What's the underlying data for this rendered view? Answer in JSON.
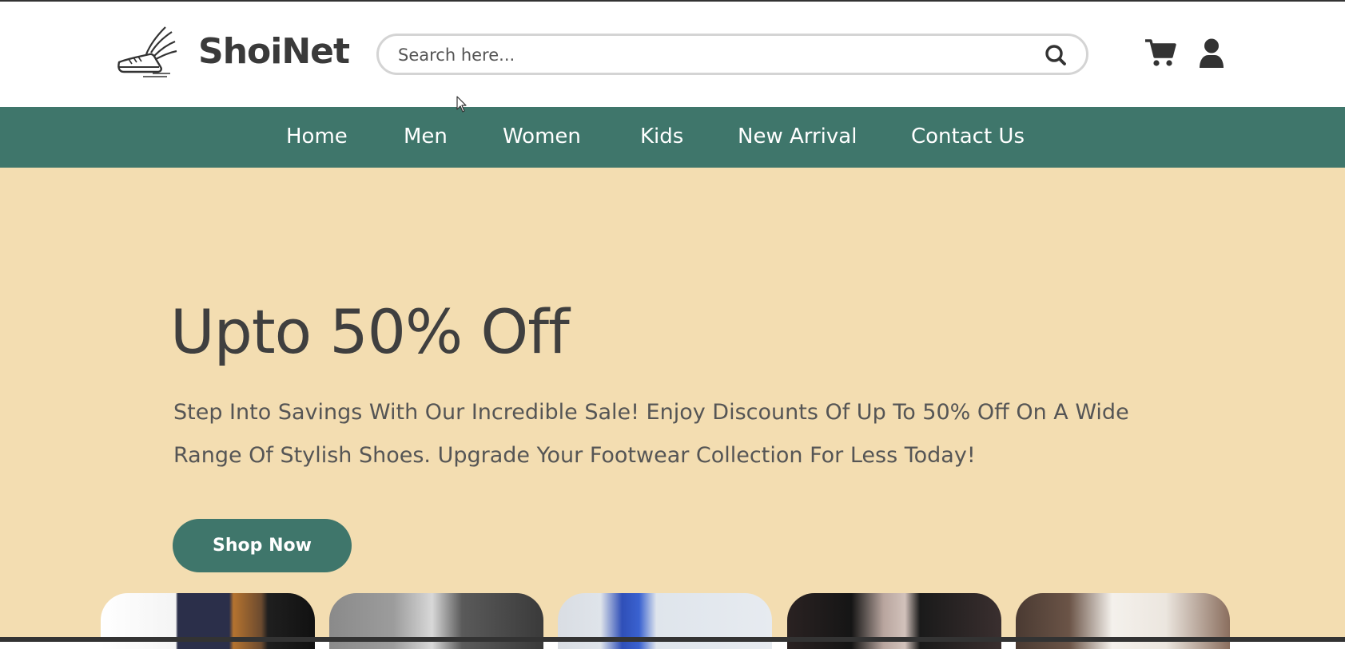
{
  "header": {
    "brand": "ShoiNet",
    "search_placeholder": "Search here...",
    "icons": {
      "logo": "winged-shoe-logo",
      "search": "search-icon",
      "cart": "cart-icon",
      "user": "user-icon"
    }
  },
  "nav": {
    "items": [
      {
        "label": "Home"
      },
      {
        "label": "Men"
      },
      {
        "label": "Women"
      },
      {
        "label": "Kids"
      },
      {
        "label": "New Arrival"
      },
      {
        "label": "Contact Us"
      }
    ]
  },
  "hero": {
    "title": "Upto 50% Off",
    "text": "Step Into Savings With Our Incredible Sale! Enjoy Discounts Of Up To 50% Off On A Wide Range Of Stylish Shoes. Upgrade Your Footwear Collection For Less Today!",
    "button_label": "Shop Now"
  },
  "colors": {
    "accent": "#3f766b",
    "hero_background": "#f3ddb1",
    "text_dark": "#3f3f3f"
  }
}
